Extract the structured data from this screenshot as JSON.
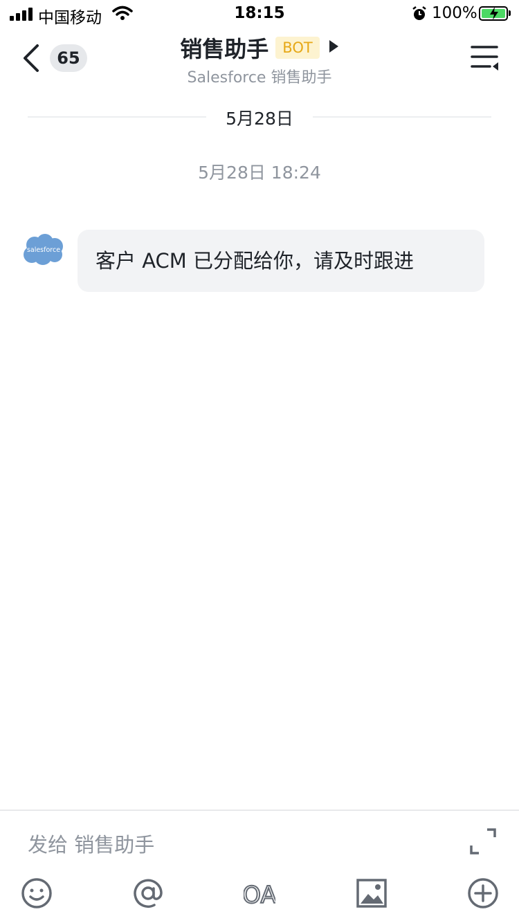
{
  "status_bar": {
    "carrier": "中国移动",
    "time": "18:15",
    "battery_percent": "100%",
    "icons": [
      "signal-icon",
      "wifi-icon",
      "alarm-icon",
      "battery-charging-icon"
    ]
  },
  "nav": {
    "unread_count": "65",
    "title": "销售助手",
    "bot_tag": "BOT",
    "subtitle": "Salesforce 销售助手",
    "icons": [
      "back-chevron-icon",
      "play-icon",
      "menu-icon"
    ]
  },
  "chat": {
    "date_separator": "5月28日",
    "message_time": "5月28日 18:24",
    "messages": [
      {
        "sender_avatar_text": "salesforce",
        "text": "客户 ACM 已分配给你，请及时跟进"
      }
    ]
  },
  "composer": {
    "placeholder": "发给 销售助手",
    "tools": [
      "emoji-icon",
      "mention-icon",
      "oa-icon",
      "image-icon",
      "plus-icon"
    ],
    "oa_label": "OA"
  },
  "colors": {
    "bot_tag_bg": "#fdf3d0",
    "bot_tag_text": "#e6a817",
    "bubble_bg": "#f2f3f5",
    "avatar_cloud": "#6c9fd6",
    "battery_fill": "#4cd964",
    "icon_gray": "#646a73"
  }
}
